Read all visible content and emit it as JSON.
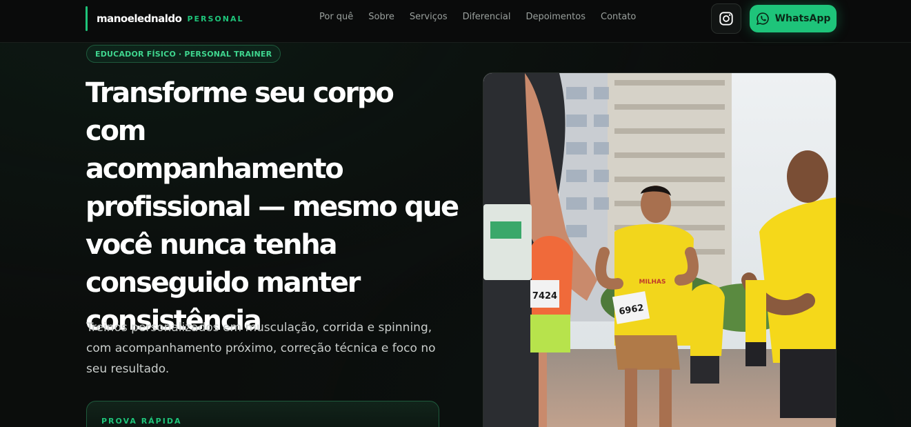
{
  "brand": {
    "name": "manoelednaldo",
    "tagline": "PERSONAL"
  },
  "nav": {
    "items": [
      {
        "label": "Por quê"
      },
      {
        "label": "Sobre"
      },
      {
        "label": "Serviços"
      },
      {
        "label": "Diferencial"
      },
      {
        "label": "Depoimentos"
      },
      {
        "label": "Contato"
      }
    ]
  },
  "header_actions": {
    "instagram_icon": "instagram-icon",
    "whatsapp_label": "WhatsApp",
    "whatsapp_icon": "whatsapp-icon"
  },
  "hero": {
    "badge": "EDUCADOR FÍSICO · PERSONAL TRAINER",
    "headline_lines": [
      "Transforme seu corpo com",
      "acompanhamento",
      "profissional — mesmo que",
      "você nunca tenha",
      "conseguido manter",
      "consistência"
    ],
    "subtext_lines": [
      "Treinos personalizados em musculação, corrida e spinning,",
      "com acompanhamento próximo, correção técnica e foco no",
      "seu resultado."
    ],
    "proof_label": "PROVA RÁPIDA",
    "photo": {
      "bibs": [
        "7424",
        "6962"
      ],
      "shirt_text": "MILHAS"
    }
  },
  "colors": {
    "accent": "#1ec47a",
    "background": "#0b0d0c",
    "nav_text": "#9aa09d"
  }
}
